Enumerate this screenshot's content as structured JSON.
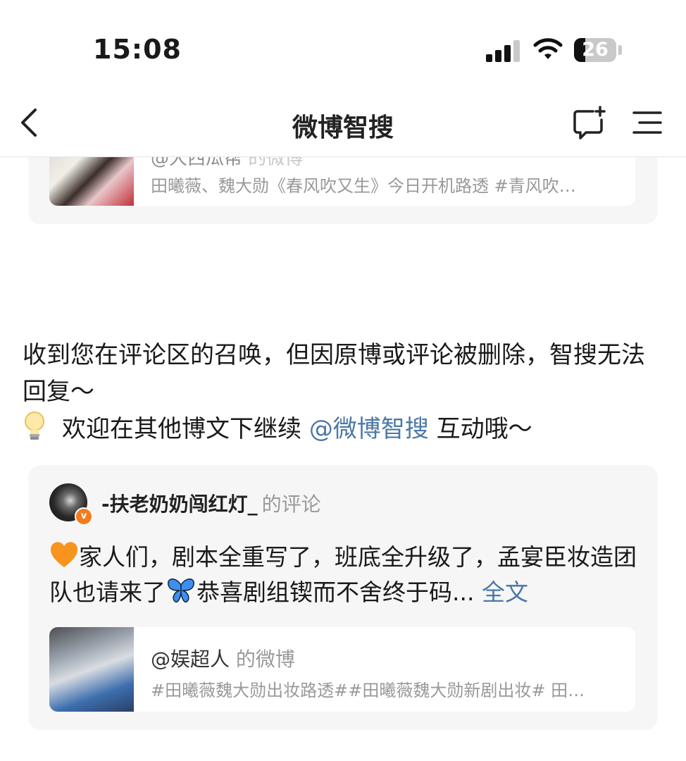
{
  "status_bar": {
    "time": "15:08",
    "battery": "26"
  },
  "nav": {
    "title": "微博智搜"
  },
  "top_card": {
    "partial_author": "@大西瓜帮",
    "partial_suffix": "的微博",
    "desc": "田曦薇、魏大勋《春风吹又生》今日开机路透  #青风吹…"
  },
  "reply": {
    "line1": "收到您在评论区的召唤，但因原博或评论被删除，智搜无法回复～",
    "line2_prefix": "欢迎在其他博文下继续",
    "line2_mention": "@微博智搜",
    "line2_suffix": "互动哦～"
  },
  "comment": {
    "author": "-扶老奶奶闯红灯_",
    "author_suffix": "的评论",
    "text_part1": "家人们，剧本全重写了，班底全升级了，孟宴臣妆造团队也请来了",
    "text_part2": "恭喜剧组锲而不舍终于码...",
    "more_label": "全文",
    "embed": {
      "title": "@娱超人",
      "title_suffix": "的微博",
      "desc": "#田曦薇魏大勋出妆路透##田曦薇魏大勋新剧出妆# 田…"
    }
  },
  "icons": {
    "back": "chevron-left-icon",
    "compose": "new-message-icon",
    "menu": "menu-icon",
    "verified_color": "#f37b1d",
    "link_color": "#4b78a7"
  }
}
